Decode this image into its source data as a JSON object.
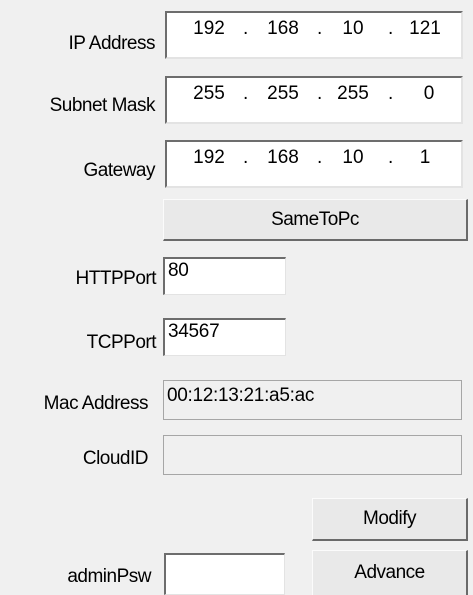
{
  "ip_address": {
    "label": "IP Address",
    "octets": [
      "192",
      "168",
      "10",
      "121"
    ]
  },
  "subnet_mask": {
    "label": "Subnet Mask",
    "octets": [
      "255",
      "255",
      "255",
      "0"
    ]
  },
  "gateway": {
    "label": "Gateway",
    "octets": [
      "192",
      "168",
      "10",
      "1"
    ]
  },
  "same_to_pc_label": "SameToPc",
  "http_port": {
    "label": "HTTPPort",
    "value": "80"
  },
  "tcp_port": {
    "label": "TCPPort",
    "value": "34567"
  },
  "mac_address": {
    "label": "Mac Address",
    "value": "00:12:13:21:a5:ac"
  },
  "cloud_id": {
    "label": "CloudID",
    "value": ""
  },
  "modify_label": "Modify",
  "admin_psw": {
    "label": "adminPsw",
    "value": ""
  },
  "advance_label": "Advance"
}
